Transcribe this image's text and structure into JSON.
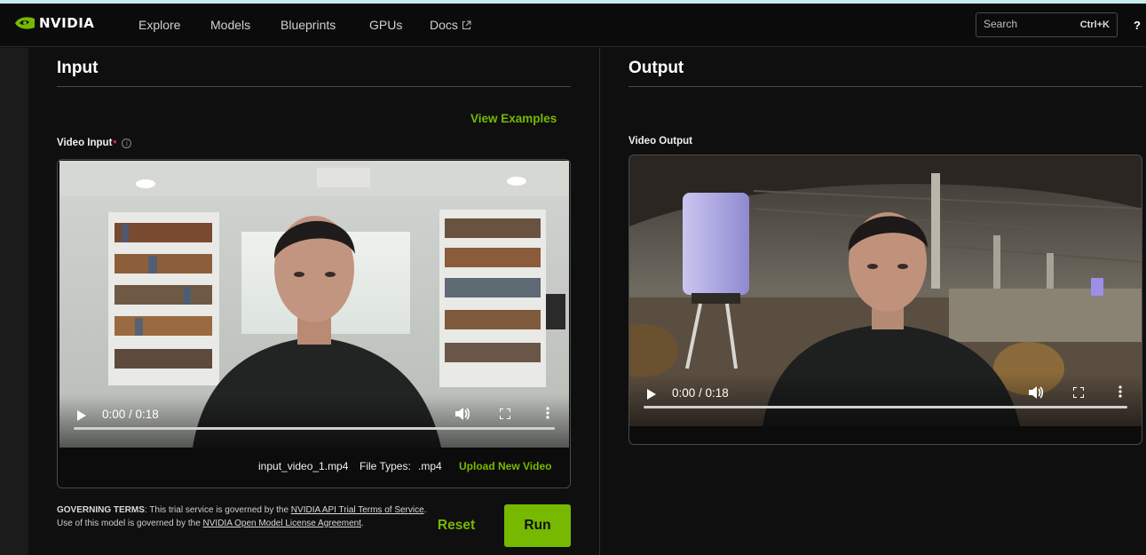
{
  "nav": {
    "brand": "NVIDIA",
    "items": [
      "Explore",
      "Models",
      "Blueprints",
      "GPUs",
      "Docs"
    ],
    "search_placeholder": "Search",
    "search_shortcut": "Ctrl+K",
    "help": "?"
  },
  "input": {
    "title": "Input",
    "view_examples": "View Examples",
    "field_label": "Video Input",
    "required_mark": "•",
    "info": "i",
    "player": {
      "time": "0:00 / 0:18",
      "progress": 0
    },
    "filename": "input_video_1.mp4",
    "file_types_label": "File Types:",
    "file_types": ".mp4",
    "upload_label": "Upload New Video"
  },
  "output": {
    "title": "Output",
    "field_label": "Video Output",
    "player": {
      "time": "0:00 / 0:18",
      "progress": 0
    }
  },
  "terms": {
    "heading": "GOVERNING TERMS",
    "text1": ": This trial service is governed by the ",
    "link1": "NVIDIA API Trial Terms of Service",
    "text2": ". Use of this model is governed by the ",
    "link2": "NVIDIA Open Model License Agreement",
    "text3": "."
  },
  "actions": {
    "reset": "Reset",
    "run": "Run"
  },
  "colors": {
    "accent": "#76b900",
    "required": "#d6303a",
    "background": "#0f0f0f"
  }
}
